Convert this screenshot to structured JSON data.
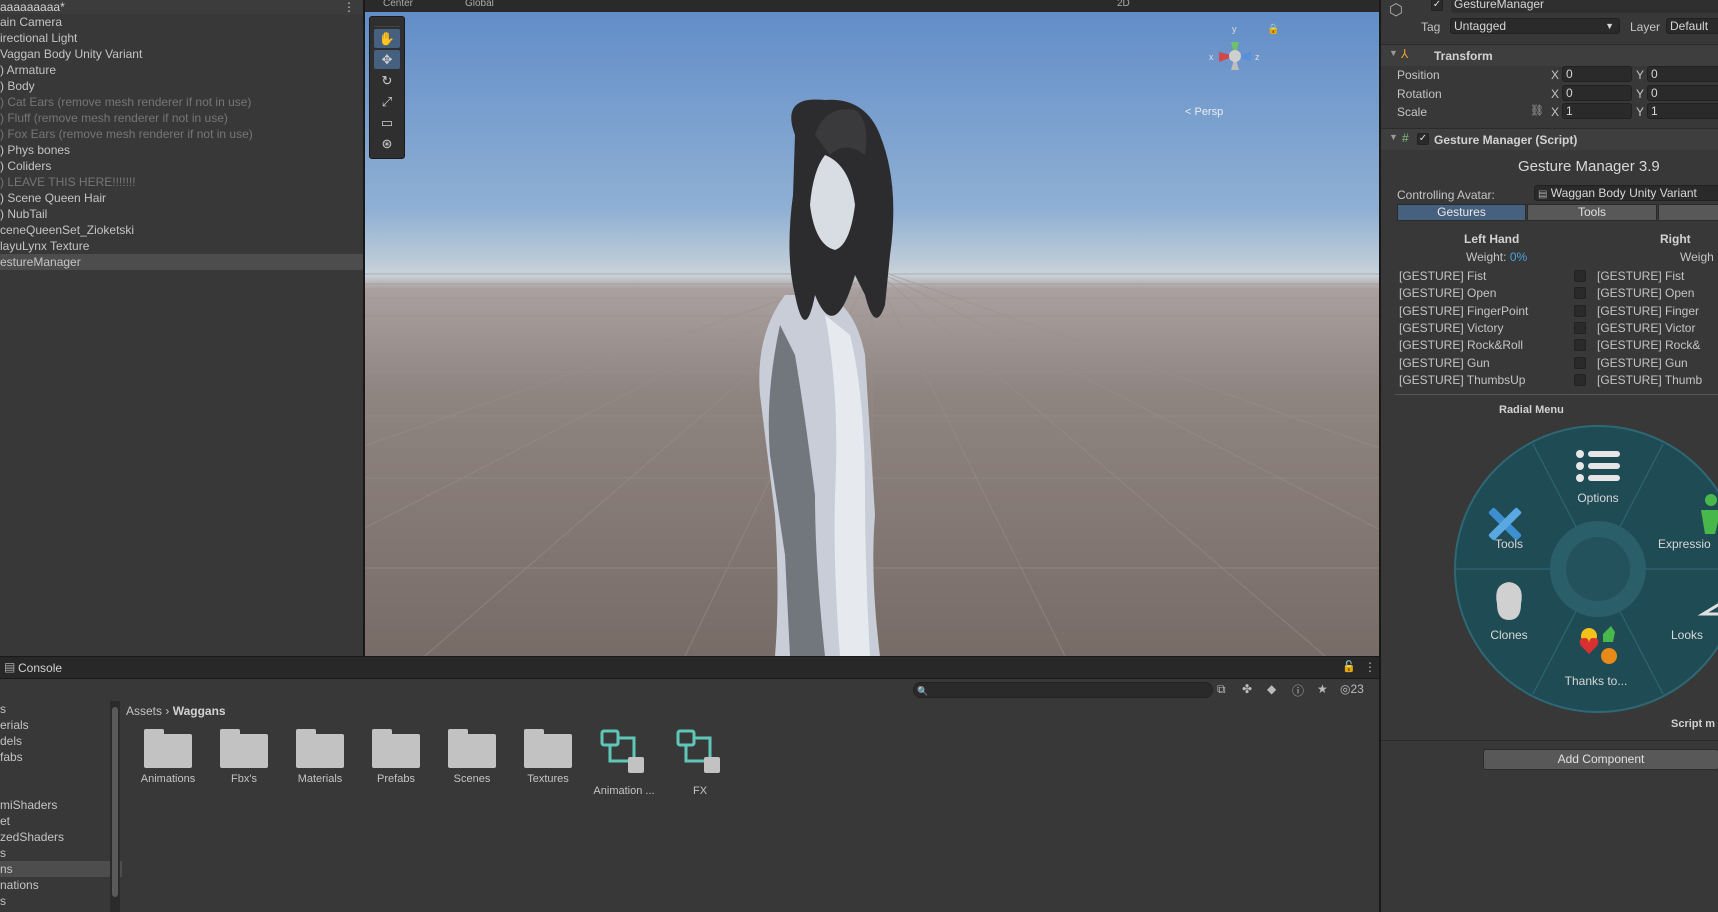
{
  "hierarchy": {
    "scene_name": "aaaaaaaaa*",
    "items": [
      {
        "label": "ain Camera",
        "dim": false
      },
      {
        "label": "irectional Light",
        "dim": false
      },
      {
        "label": "Vaggan Body Unity Variant",
        "dim": false
      },
      {
        "label": ") Armature",
        "dim": false
      },
      {
        "label": ") Body",
        "dim": false
      },
      {
        "label": ") Cat Ears (remove mesh renderer if not in use)",
        "dim": true
      },
      {
        "label": ") Fluff (remove mesh renderer if not in use)",
        "dim": true
      },
      {
        "label": ") Fox Ears (remove mesh renderer if not in use)",
        "dim": true
      },
      {
        "label": ") Phys bones",
        "dim": false
      },
      {
        "label": ") Coliders",
        "dim": false
      },
      {
        "label": ") LEAVE THIS HERE!!!!!!!",
        "dim": true
      },
      {
        "label": ") Scene Queen Hair",
        "dim": false
      },
      {
        "label": ") NubTail",
        "dim": false
      },
      {
        "label": "ceneQueenSet_Zioketski",
        "dim": false
      },
      {
        "label": "layuLynx Texture",
        "dim": false
      },
      {
        "label": "estureManager",
        "dim": false,
        "selected": true
      }
    ]
  },
  "scene_view": {
    "toolbar_left": "Center",
    "toolbar_global": "Global",
    "mode_2d": "2D",
    "persp_label": "< Persp",
    "axis_x": "x",
    "axis_y": "y",
    "axis_z": "z",
    "tools": [
      {
        "icon": "hand-tool-icon",
        "glyph": "✋",
        "active": true
      },
      {
        "icon": "move-tool-icon",
        "glyph": "✥",
        "active": true
      },
      {
        "icon": "rotate-tool-icon",
        "glyph": "↻",
        "active": false
      },
      {
        "icon": "scale-tool-icon",
        "glyph": "⤢",
        "active": false
      },
      {
        "icon": "rect-tool-icon",
        "glyph": "▭",
        "active": false
      },
      {
        "icon": "transform-tool-icon",
        "glyph": "⊛",
        "active": false
      }
    ]
  },
  "inspector": {
    "object_name": "GestureManager",
    "tag_label": "Tag",
    "tag_value": "Untagged",
    "layer_label": "Layer",
    "layer_value": "Default",
    "transform": {
      "title": "Transform",
      "rows": [
        {
          "label": "Position",
          "x": "0",
          "y": "0"
        },
        {
          "label": "Rotation",
          "x": "0",
          "y": "0"
        },
        {
          "label": "Scale",
          "x": "1",
          "y": "1"
        }
      ],
      "x_axis": "X",
      "y_axis": "Y"
    },
    "gesture_manager": {
      "component_title": "Gesture Manager (Script)",
      "title": "Gesture Manager 3.9",
      "controlling_label": "Controlling Avatar:",
      "controlling_value": "Waggan Body Unity Variant",
      "tabs": [
        "Gestures",
        "Tools"
      ],
      "left_hand": "Left Hand",
      "right_hand": "Right",
      "weight_label": "Weight:",
      "weight_value": "0%",
      "right_weight_label": "Weigh",
      "left_gestures": [
        "[GESTURE] Fist",
        "[GESTURE] Open",
        "[GESTURE] FingerPoint",
        "[GESTURE] Victory",
        "[GESTURE] Rock&Roll",
        "[GESTURE] Gun",
        "[GESTURE] ThumbsUp"
      ],
      "right_gestures": [
        "[GESTURE] Fist",
        "[GESTURE] Open",
        "[GESTURE] Finger",
        "[GESTURE] Victor",
        "[GESTURE] Rock&",
        "[GESTURE] Gun",
        "[GESTURE] Thumb"
      ],
      "radial_title": "Radial Menu",
      "radial_items": {
        "options": "Options",
        "tools": "Tools",
        "expressions": "Expressio",
        "clones": "Clones",
        "looks": "Looks",
        "thanks": "Thanks to..."
      },
      "script_label": "Script m"
    },
    "add_component": "Add Component"
  },
  "bottom_panel": {
    "tab_label": "Console",
    "breadcrumb_root": "Assets",
    "breadcrumb_current": "Waggans",
    "hidden_count": "23",
    "tree_items": [
      {
        "label": "s",
        "selected": false
      },
      {
        "label": "erials",
        "selected": false
      },
      {
        "label": "dels",
        "selected": false
      },
      {
        "label": "fabs",
        "selected": false
      },
      {
        "label": "",
        "selected": false
      },
      {
        "label": "",
        "selected": false
      },
      {
        "label": "miShaders",
        "selected": false
      },
      {
        "label": "et",
        "selected": false
      },
      {
        "label": "zedShaders",
        "selected": false
      },
      {
        "label": "s",
        "selected": false
      },
      {
        "label": "ns",
        "selected": true
      },
      {
        "label": "nations",
        "selected": false
      },
      {
        "label": "s",
        "selected": false
      }
    ],
    "assets": [
      {
        "name": "Animations",
        "kind": "folder"
      },
      {
        "name": "Fbx's",
        "kind": "folder"
      },
      {
        "name": "Materials",
        "kind": "folder"
      },
      {
        "name": "Prefabs",
        "kind": "folder"
      },
      {
        "name": "Scenes",
        "kind": "folder"
      },
      {
        "name": "Textures",
        "kind": "folder"
      },
      {
        "name": "Animation ...",
        "kind": "controller"
      },
      {
        "name": "FX",
        "kind": "controller"
      }
    ]
  },
  "colors": {
    "accent": "#46607f",
    "teal": "#5fc7b8",
    "radial_bg": "#1f4b55"
  }
}
